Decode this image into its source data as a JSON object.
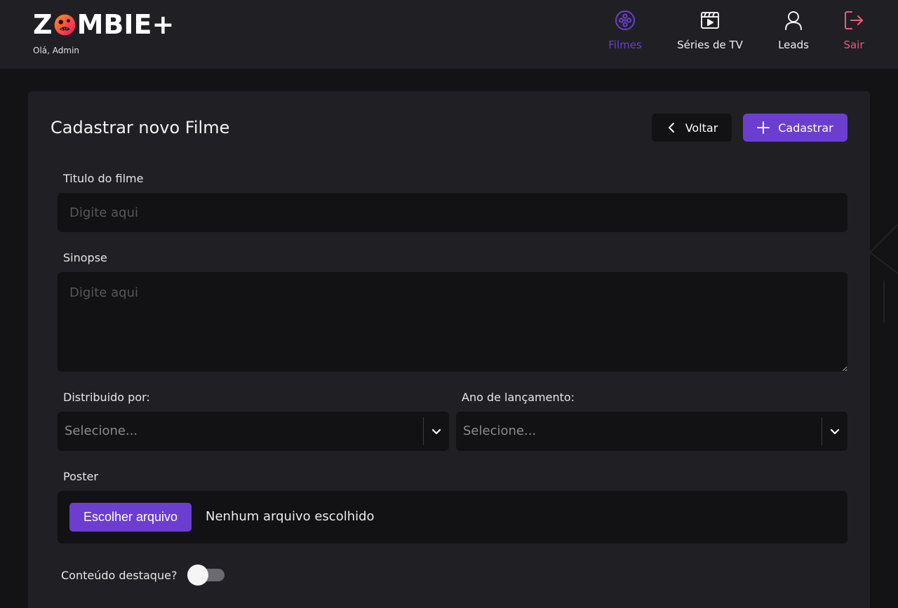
{
  "header": {
    "logo_prefix": "Z",
    "logo_suffix": "MBIE+",
    "greeting": "Olá, Admin",
    "nav": [
      {
        "label": "Filmes",
        "icon": "film-reel-icon",
        "active": true
      },
      {
        "label": "Séries de TV",
        "icon": "clapperboard-icon",
        "active": false
      },
      {
        "label": "Leads",
        "icon": "user-icon",
        "active": false
      },
      {
        "label": "Sair",
        "icon": "logout-icon",
        "active": false
      }
    ]
  },
  "form": {
    "title": "Cadastrar novo Filme",
    "back_label": "Voltar",
    "submit_label": "Cadastrar",
    "title_field": {
      "label": "Titulo do filme",
      "placeholder": "Digite aqui",
      "value": ""
    },
    "synopsis_field": {
      "label": "Sinopse",
      "placeholder": "Digite aqui",
      "value": ""
    },
    "company_field": {
      "label": "Distribuido por:",
      "placeholder": "Selecione..."
    },
    "year_field": {
      "label": "Ano de lançamento:",
      "placeholder": "Selecione..."
    },
    "poster_field": {
      "label": "Poster",
      "button_label": "Escolher arquivo",
      "status": "Nenhum arquivo escolhido"
    },
    "featured_field": {
      "label": "Conteúdo destaque?",
      "checked": false
    }
  },
  "colors": {
    "accent": "#6b3ecf",
    "logout": "#ee5a7a",
    "header_bg": "#202024",
    "page_bg": "#131315",
    "input_bg": "#121214"
  }
}
